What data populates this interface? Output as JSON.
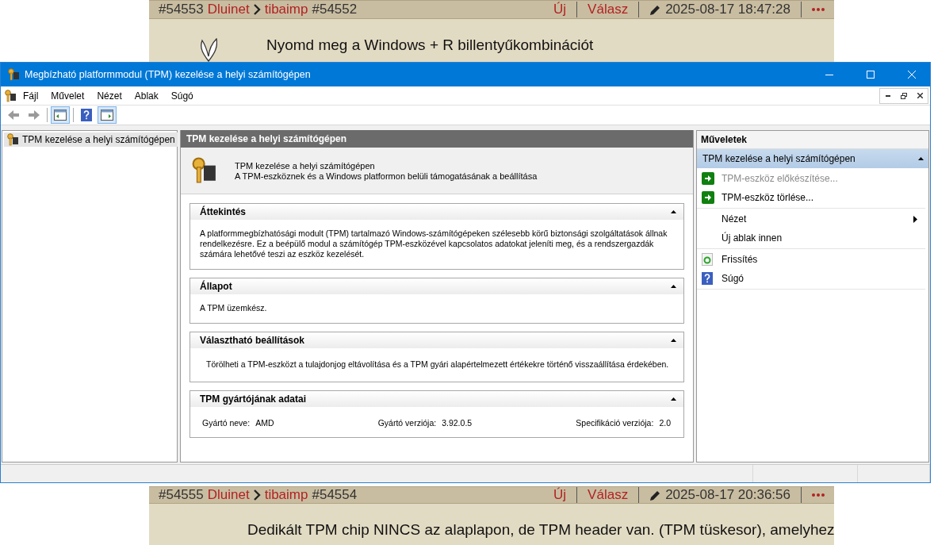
{
  "posts_top": [
    {
      "number": "#54553",
      "author": "Dluinet",
      "reply_to": "tibaimp",
      "reply_number": "#54552",
      "new_label": "Új",
      "reply_label": "Válasz",
      "timestamp": "2025-08-17 18:47:28",
      "body": "Nyomd meg a Windows + R billentyűkombinációt"
    }
  ],
  "window": {
    "title": "Megbízható platformmodul (TPM) kezelése a helyi számítógépen",
    "menu": [
      "Fájl",
      "Művelet",
      "Nézet",
      "Ablak",
      "Súgó"
    ],
    "toolbar": [
      {
        "kind": "back",
        "disabled": true
      },
      {
        "kind": "forward",
        "disabled": true
      },
      {
        "kind": "tree_toggle",
        "on": true
      },
      {
        "kind": "help",
        "on": false
      },
      {
        "kind": "action_toggle",
        "on": true
      }
    ],
    "tree": [
      {
        "label": "TPM kezelése a helyi számítógépen",
        "selected": true
      }
    ],
    "main": {
      "header": "TPM kezelése a helyi számítógépen",
      "intro_title": "TPM kezelése a helyi számítógépen",
      "intro_text": "A TPM-eszköznek és a Windows platformon belüli támogatásának a beállítása",
      "sections": [
        {
          "kind": "text",
          "title": "Áttekintés",
          "expanded": true,
          "text": "A platformmegbízhatósági modult (TPM) tartalmazó Windows-számítógépeken szélesebb körű biztonsági szolgáltatások állnak rendelkezésre. Ez a beépülő modul a számítógép TPM-eszközével kapcsolatos adatokat jeleníti meg, és a rendszergazdák számára lehetővé teszi az eszköz kezelését."
        },
        {
          "kind": "text",
          "title": "Állapot",
          "expanded": true,
          "text": "A TPM üzemkész."
        },
        {
          "kind": "note",
          "title": "Választható beállítások",
          "expanded": true,
          "text": "Törölheti a TPM-eszközt a tulajdonjog eltávolítása és a TPM gyári alapértelmezett értékekre történő visszaállítása érdekében."
        },
        {
          "kind": "fields",
          "title": "TPM gyártójának adatai",
          "expanded": true,
          "fields": [
            {
              "label": "Gyártó neve:",
              "value": "AMD"
            },
            {
              "label": "Gyártó verziója:",
              "value": "3.92.0.5"
            },
            {
              "label": "Specifikáció verziója:",
              "value": "2.0"
            }
          ]
        }
      ]
    },
    "actions": {
      "title": "Műveletek",
      "group": {
        "label": "TPM kezelése a helyi számítógépen",
        "expanded": true
      },
      "groups": [
        [
          {
            "kind": "run",
            "label": "TPM-eszköz előkészítése...",
            "disabled": true
          },
          {
            "kind": "run",
            "label": "TPM-eszköz törlése...",
            "disabled": false
          }
        ],
        [
          {
            "kind": "submenu",
            "label": "Nézet",
            "disabled": false
          },
          {
            "kind": "plain",
            "label": "Új ablak innen",
            "disabled": false
          }
        ],
        [
          {
            "kind": "refresh",
            "label": "Frissítés",
            "disabled": false
          },
          {
            "kind": "help",
            "label": "Súgó",
            "disabled": false
          }
        ]
      ]
    }
  },
  "posts_bottom": [
    {
      "number": "#54555",
      "author": "Dluinet",
      "reply_to": "tibaimp",
      "reply_number": "#54554",
      "new_label": "Új",
      "reply_label": "Válasz",
      "timestamp": "2025-08-17 20:36:56",
      "body": "Dedikált TPM chip NINCS az alaplapon, de TPM header van. (TPM tüskesor), amelyhez"
    }
  ]
}
